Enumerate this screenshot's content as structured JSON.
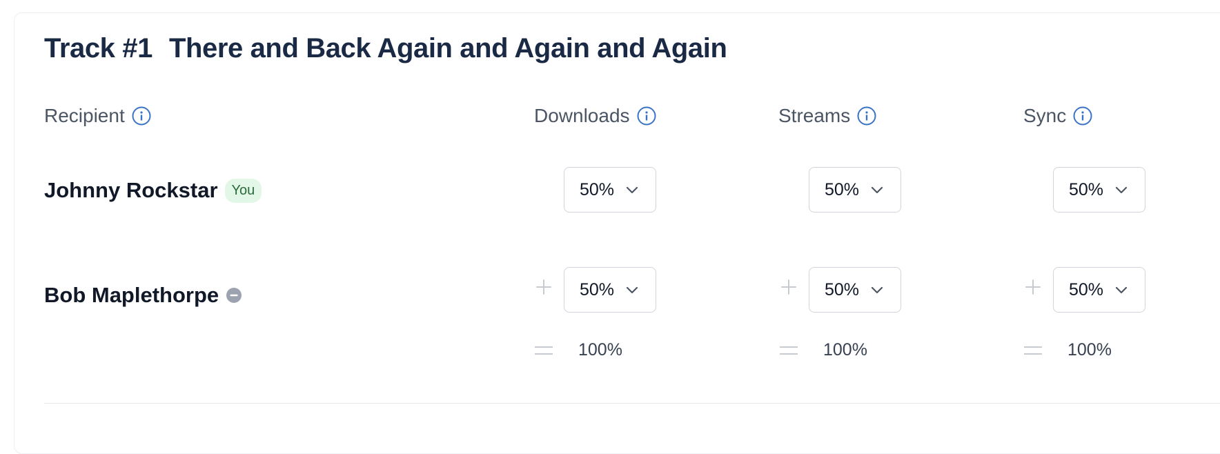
{
  "track": {
    "number_label": "Track #1",
    "title": "There and Back Again and Again and Again"
  },
  "columns": {
    "recipient": "Recipient",
    "downloads": "Downloads",
    "streams": "Streams",
    "sync": "Sync"
  },
  "recipients": [
    {
      "name": "Johnny Rockstar",
      "badge": "You",
      "downloads": "50%",
      "streams": "50%",
      "sync": "50%"
    },
    {
      "name": "Bob Maplethorpe",
      "downloads": "50%",
      "streams": "50%",
      "sync": "50%"
    }
  ],
  "totals": {
    "downloads": "100%",
    "streams": "100%",
    "sync": "100%"
  },
  "colors": {
    "title": "#1b2a44",
    "info_icon": "#3b73c4",
    "badge_bg": "#e3f7e8",
    "badge_text": "#2a6b3c",
    "remove_icon": "#9ca3af"
  },
  "icons": [
    "info-icon",
    "chevron-down-icon",
    "plus-icon",
    "equals-icon",
    "remove-icon"
  ]
}
